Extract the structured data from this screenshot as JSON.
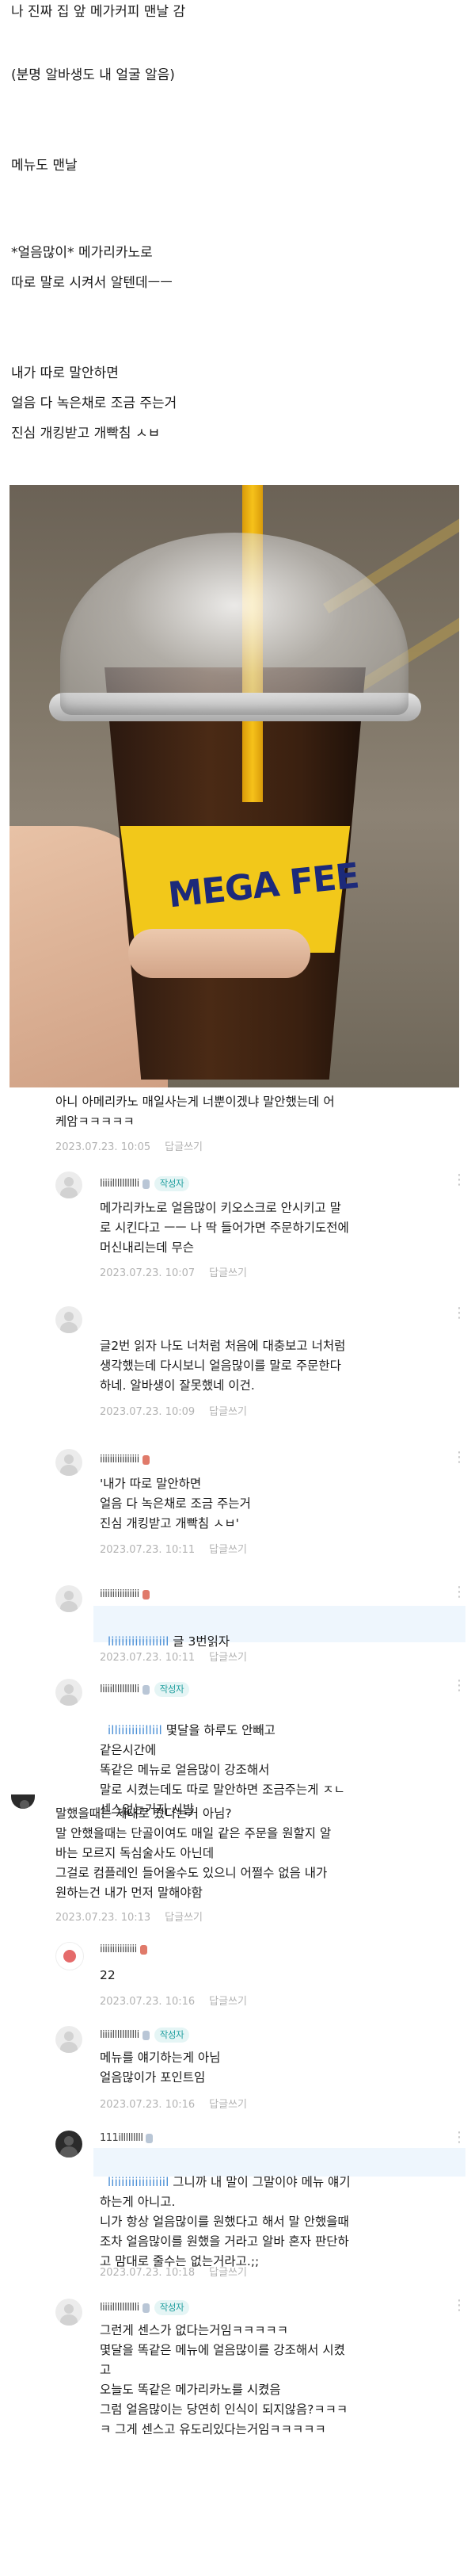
{
  "post": {
    "lines": [
      "나 진짜 집 앞 메가커피 맨날 감",
      "(분명 알바생도 내 얼굴 알음)",
      "메뉴도 맨날",
      "*얼음많이* 메가리카노로",
      "따로 말로 시켜서 알텐데ㅡㅡ",
      "내가 따로 말안하면",
      "얼음 다 녹은채로 조금 주는거",
      "진심 개킹받고 개빡침 ㅅㅂ"
    ],
    "photo": {
      "brand_text": "MEGA FEE",
      "description_icon": "photo-image"
    }
  },
  "labels": {
    "reply": "답글쓰기",
    "writer": "작성자",
    "more": "⋮"
  },
  "comments": [
    {
      "nick": "",
      "text": "아니 아메리카노 매일사는게 너뿐이겠냐 말안했는데 어\n케암ㅋㅋㅋㅋㅋ",
      "date": "2023.07.23. 10:05"
    },
    {
      "nick": "liiiilllllllllli",
      "writer": true,
      "text": "메가리카노로 얼음많이 키오스크로 안시키고 말\n로 시킨다고 ㅡㅡ 나 딱 들어가면 주문하기도전에\n머신내리는데 무슨",
      "date": "2023.07.23. 10:07"
    },
    {
      "nick": "",
      "text": "글2번 읽자 나도 너처럼 처음에 대충보고 너처럼\n생각했는데 다시보니 얼음많이를 말로 주문한다\n하네. 알바생이 잘못했네 이건.",
      "date": "2023.07.23. 10:09"
    },
    {
      "nick": "iiiiiiiiiiiiiiii",
      "text": "'내가 따로 말안하면\n얼음 다 녹은채로 조금 주는거\n진심 개킹받고 개빡침 ㅅㅂ'",
      "date": "2023.07.23. 10:11"
    },
    {
      "nick": "iiiiiiiiiiiiiiii",
      "mention": "liiiiiiiiiiiiiiiil",
      "text": " 글 3번읽자",
      "date": "2023.07.23. 10:11"
    },
    {
      "nick": "liiiilllllllllli",
      "writer": true,
      "mention": "illiiiiiiiilliil",
      "text": " 몇달을 하루도 안빼고\n같은시간에\n똑같은 메뉴로 얼음많이 강조해서\n말로 시켰는데도 따로 말안하면 조금주는게 ㅈㄴ\n센스없는거지 시발",
      "date": ""
    },
    {
      "nick": "",
      "text": "말했을때는 제대로 줬다는거 아님?\n말 안했을때는 단골이여도 매일 같은 주문을 원할지 알\n바는 모르지 독심술사도 아닌데\n그걸로 컴플레인 들어올수도 있으니 어쩔수 없음 내가\n원하는건 내가 먼저 말해야함",
      "date": "2023.07.23. 10:13"
    },
    {
      "nick": "iiiiiiiiiiiiiii",
      "text": "22",
      "date": "2023.07.23. 10:16"
    },
    {
      "nick": "liiiilllllllllli",
      "writer": true,
      "text": "메뉴를 얘기하는게 아님\n얼음많이가 포인트임",
      "date": "2023.07.23. 10:16"
    },
    {
      "nick": "111illlllllll",
      "mention": "liiiiiiiiiiiiiiiil",
      "text": " 그니까 내 말이 그말이야 메뉴 얘기\n하는게 아니고.\n니가 항상 얼음많이를 원했다고 해서 말 안했을때\n조차 얼음많이를 원했을 거라고 알바 혼자 판단하\n고 맘대로 줄수는 없는거라고.;;",
      "date": "2023.07.23. 10:18"
    },
    {
      "nick": "liiiilllllllllli",
      "writer": true,
      "text": "그런게 센스가 없다는거임ㅋㅋㅋㅋㅋ\n몇달을 똑같은 메뉴에 얼음많이를 강조해서 시켰\n고\n오늘도 똑같은 메가리카노를 시켰음\n그럼 얼음많이는 당연히 인식이 되지않음?ㅋㅋㅋ\nㅋ 그게 센스고 유도리있다는거임ㅋㅋㅋㅋㅋ",
      "date": ""
    }
  ]
}
